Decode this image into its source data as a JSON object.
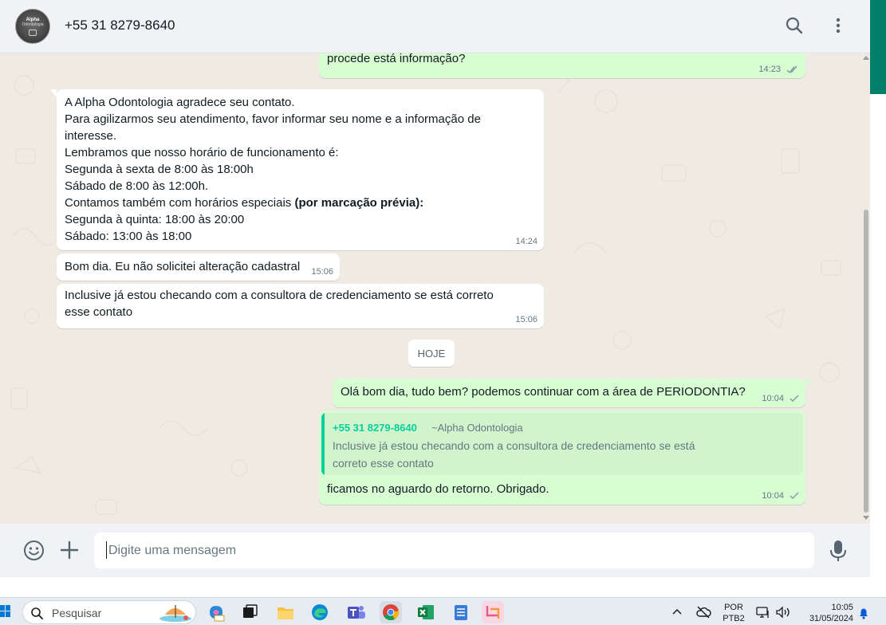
{
  "header": {
    "avatar_text_top": "Alpha",
    "avatar_text_sub": "Odontologia",
    "contact_name": "+55 31 8279-8640"
  },
  "messages": {
    "m1": {
      "text": "procede está informação?",
      "time": "14:23"
    },
    "m2": {
      "lines": [
        "A Alpha Odontologia agradece seu contato.",
        "Para agilizarmos seu atendimento, favor informar seu nome e a informação de",
        "interesse.",
        "Lembramos que nosso horário de funcionamento é:",
        "Segunda à sexta de 8:00 às 18:00h",
        "Sábado de 8:00 às 12:00h.",
        "Contamos também com horários especiais",
        "Segunda à quinta: 18:00 às 20:00",
        "Sábado: 13:00 às 18:00"
      ],
      "bold_suffix": " (por marcação prévia):",
      "time": "14:24"
    },
    "m3": {
      "text": "Bom dia. Eu não solicitei alteração cadastral",
      "time": "15:06"
    },
    "m4": {
      "text": "Inclusive já estou checando com a consultora de credenciamento se está correto esse contato",
      "time": "15:06"
    },
    "date_chip": "HOJE",
    "m5": {
      "text": "Olá bom dia, tudo bem? podemos continuar com a área de PERIODONTIA?",
      "time": "10:04"
    },
    "m6": {
      "quote_author": "+55 31 8279-8640",
      "quote_pushname": "~Alpha Odontologia",
      "quote_text": "Inclusive já estou checando com a consultora de credenciamento se está correto esse contato",
      "text": "ficamos no aguardo do retorno. Obrigado.",
      "time": "10:04"
    }
  },
  "composer": {
    "placeholder": "Digite uma mensagem"
  },
  "taskbar": {
    "search_label": "Pesquisar",
    "lang_line1": "POR",
    "lang_line2": "PTB2",
    "time": "10:05",
    "date": "31/05/2024"
  },
  "colors": {
    "outgoing_bubble": "#d9fdd3",
    "incoming_bubble": "#ffffff",
    "chat_background": "#efeae2",
    "accent": "#00a884",
    "quote_author": "#06cf9c"
  }
}
